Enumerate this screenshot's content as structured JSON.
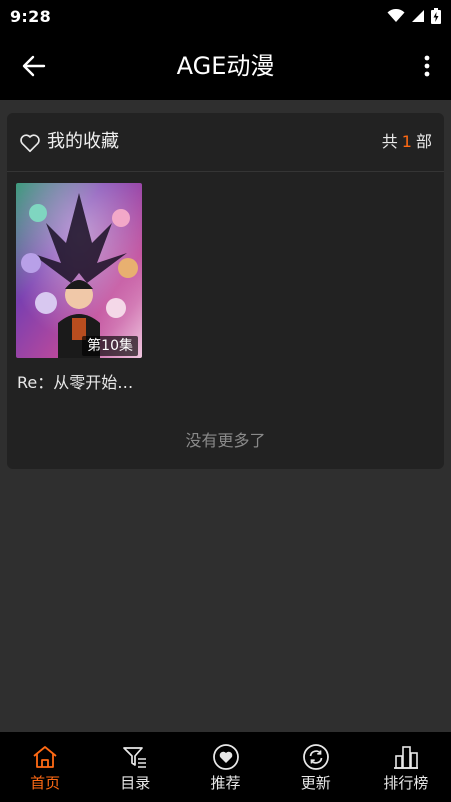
{
  "status_bar": {
    "time": "9:28"
  },
  "app_bar": {
    "title": "AGE动漫"
  },
  "favorites": {
    "title": "我的收藏",
    "count_prefix": "共",
    "count": "1",
    "count_suffix": "部",
    "items": [
      {
        "title": "Re：从零开始…",
        "episode": "第10集"
      }
    ],
    "no_more_text": "没有更多了"
  },
  "bottom_nav": {
    "items": [
      {
        "label": "首页",
        "icon": "home-icon",
        "active": true
      },
      {
        "label": "目录",
        "icon": "filter-list-icon",
        "active": false
      },
      {
        "label": "推荐",
        "icon": "heart-circle-icon",
        "active": false
      },
      {
        "label": "更新",
        "icon": "refresh-circle-icon",
        "active": false
      },
      {
        "label": "排行榜",
        "icon": "buildings-icon",
        "active": false
      }
    ]
  },
  "colors": {
    "accent": "#ff6a14",
    "background": "#2f2f2f",
    "card": "#222222",
    "bars": "#000000"
  }
}
